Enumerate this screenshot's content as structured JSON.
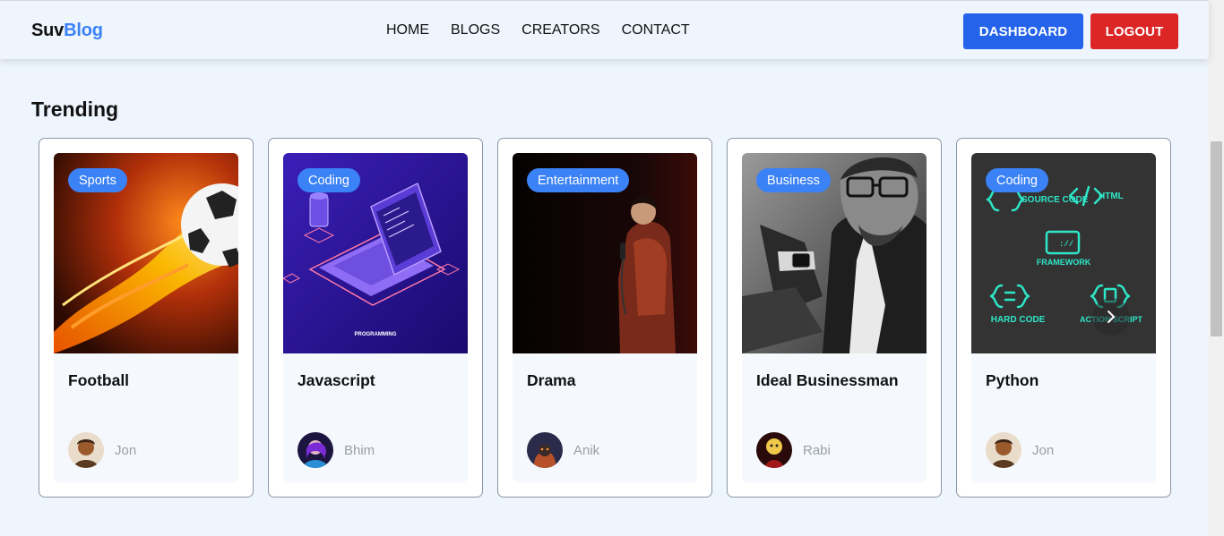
{
  "header": {
    "logo_part1": "Suv",
    "logo_part2": "Blog",
    "nav": [
      "HOME",
      "BLOGS",
      "CREATORS",
      "CONTACT"
    ],
    "dashboard_label": "DASHBOARD",
    "logout_label": "LOGOUT"
  },
  "section": {
    "title": "Trending"
  },
  "cards": [
    {
      "tag": "Sports",
      "title": "Football",
      "author": "Jon",
      "image_icon": "football-fire-image"
    },
    {
      "tag": "Coding",
      "title": "Javascript",
      "author": "Bhim",
      "image_icon": "laptop-isometric-image",
      "image_caption": "PROGRAMMING"
    },
    {
      "tag": "Entertainment",
      "title": "Drama",
      "author": "Anik",
      "image_icon": "stage-performer-image"
    },
    {
      "tag": "Business",
      "title": "Ideal Businessman",
      "author": "Rabi",
      "image_icon": "businessman-watch-image"
    },
    {
      "tag": "Coding",
      "title": "Python",
      "author": "Jon",
      "image_icon": "code-icons-image",
      "image_labels": [
        "SOURCE CODE",
        "HTML",
        "FRAMEWORK",
        "HARD CODE",
        "ACTION SCRIPT"
      ]
    }
  ],
  "colors": {
    "accent": "#3b82f6",
    "dashboard": "#2563eb",
    "logout": "#dc2626",
    "background": "#eef5fd"
  }
}
